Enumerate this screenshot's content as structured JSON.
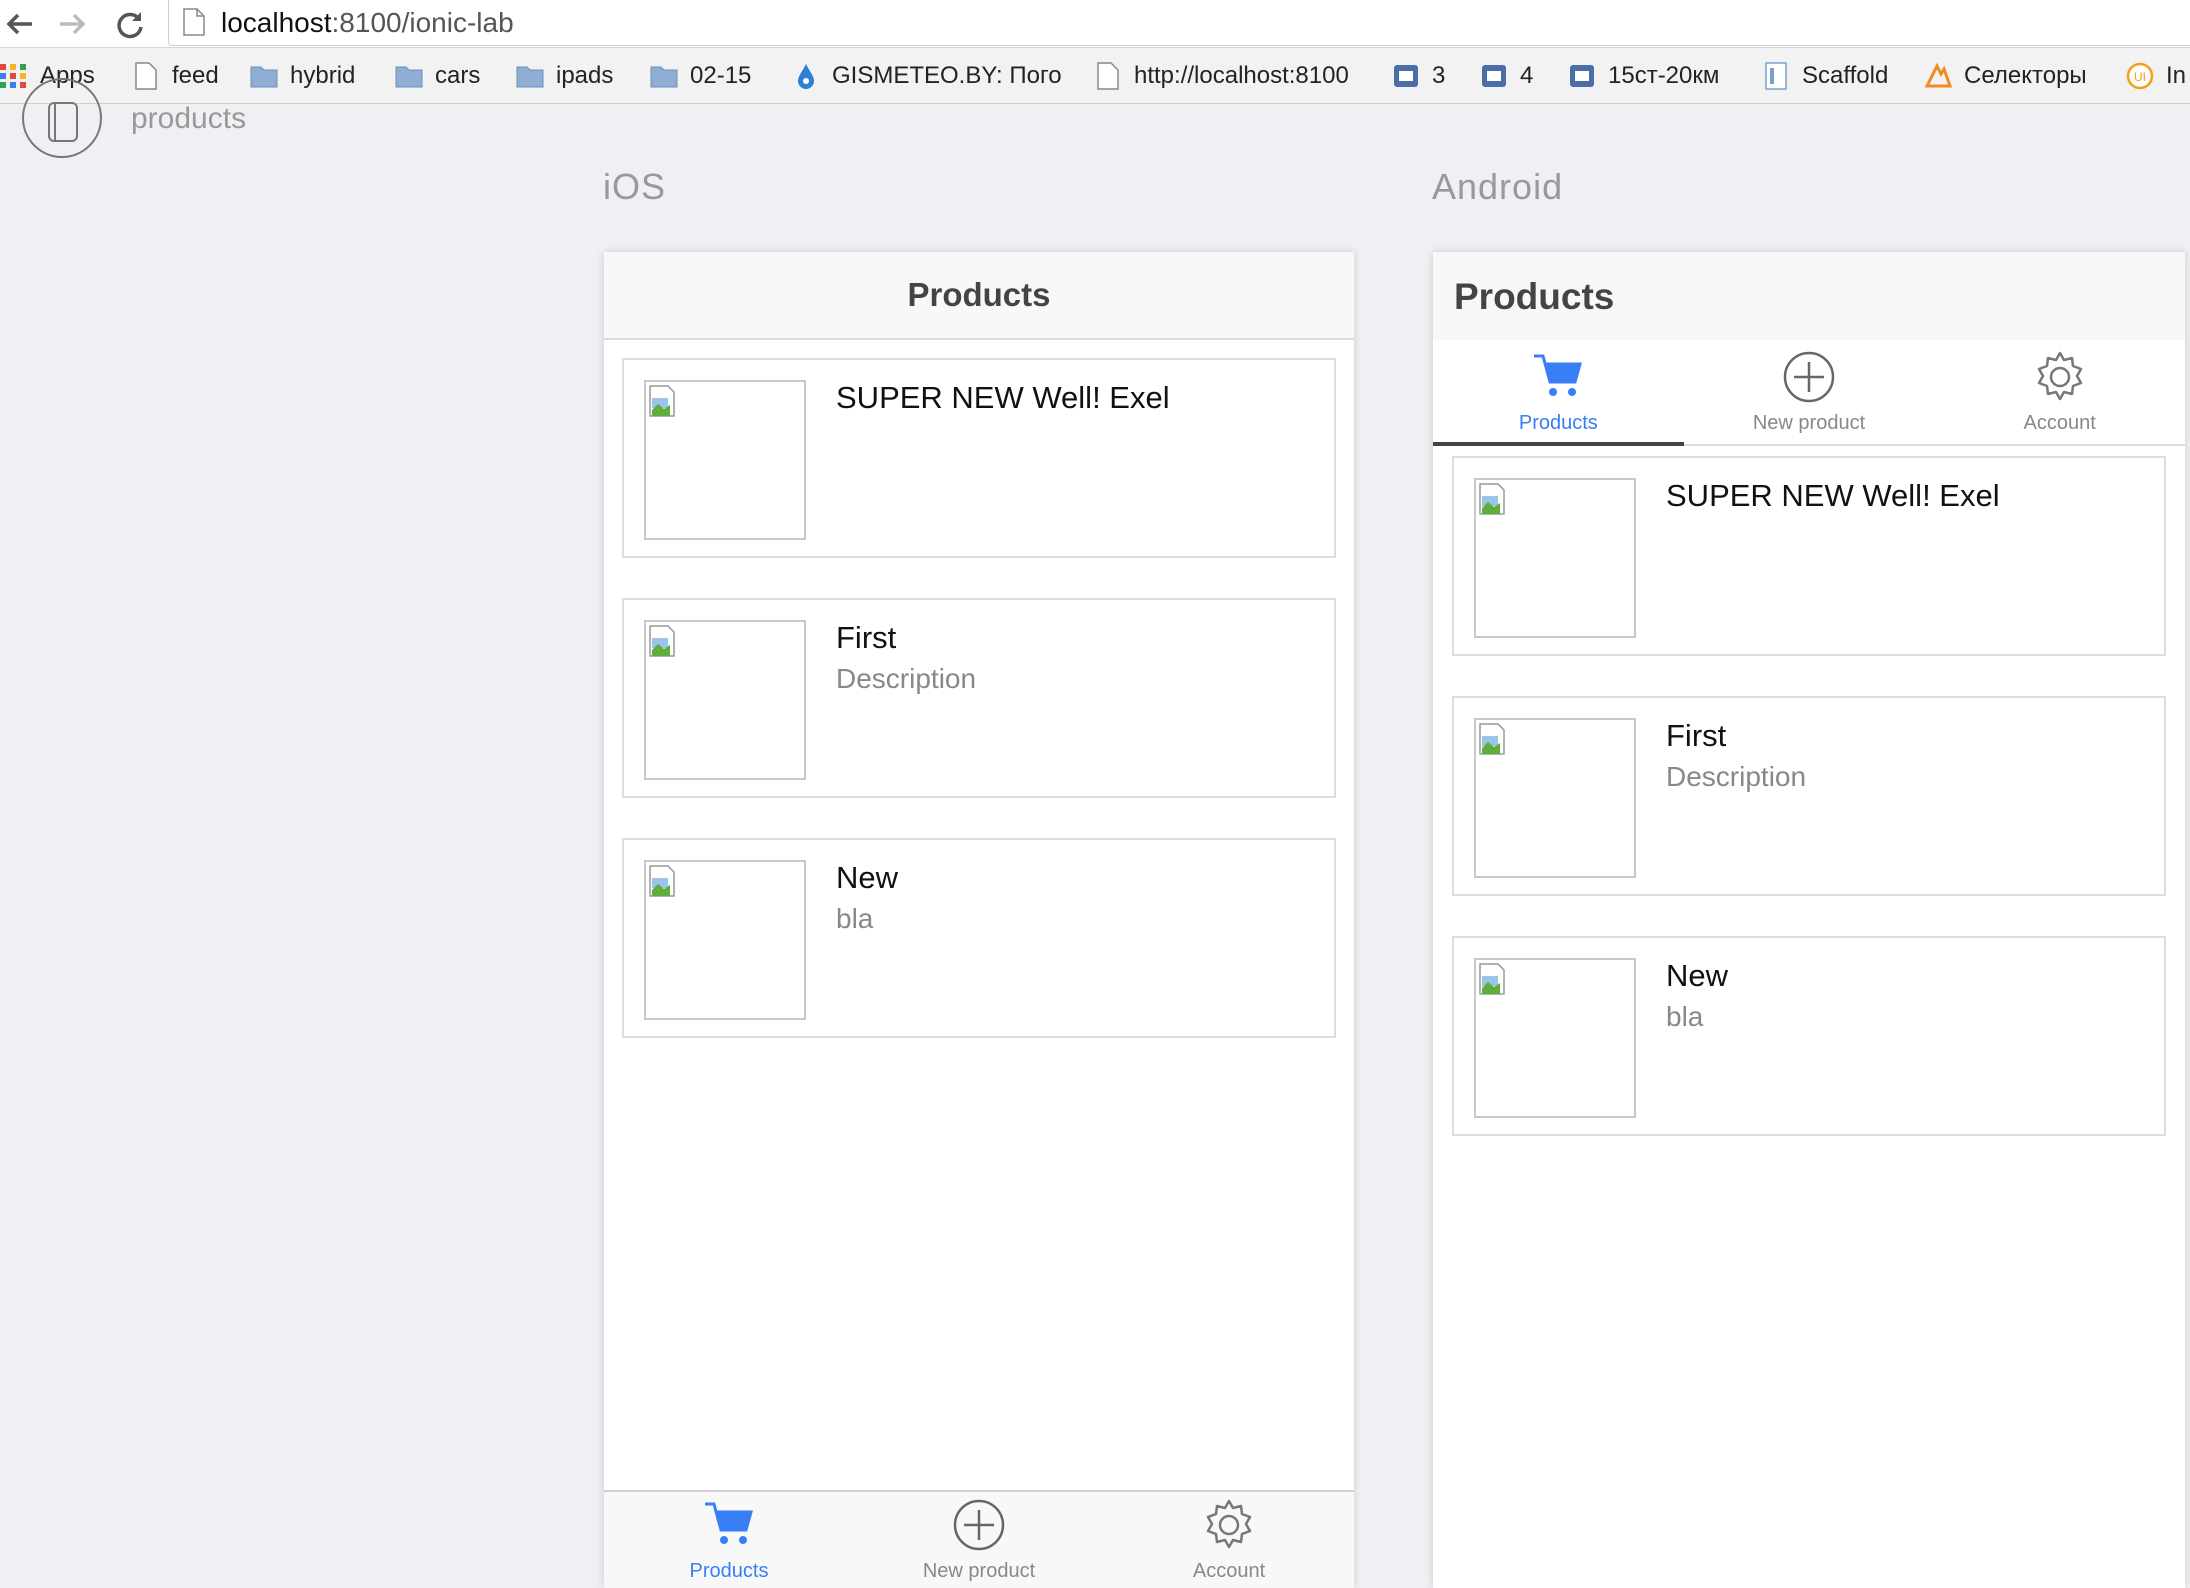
{
  "browser": {
    "url_host": "localhost",
    "url_rest": ":8100/ionic-lab",
    "bookmarks": [
      {
        "label": "Apps",
        "icon": "apps-grid-icon"
      },
      {
        "label": "feed",
        "icon": "page-icon"
      },
      {
        "label": "hybrid",
        "icon": "folder-icon"
      },
      {
        "label": "cars",
        "icon": "folder-icon"
      },
      {
        "label": "ipads",
        "icon": "folder-icon"
      },
      {
        "label": "02-15",
        "icon": "folder-icon"
      },
      {
        "label": "GISMETEO.BY: Пого",
        "icon": "drop-icon"
      },
      {
        "label": "http://localhost:8100",
        "icon": "page-icon"
      },
      {
        "label": "3",
        "icon": "vk-icon"
      },
      {
        "label": "4",
        "icon": "vk-icon"
      },
      {
        "label": "15ст-20км",
        "icon": "vk-icon"
      },
      {
        "label": "Scaffold",
        "icon": "doc-icon"
      },
      {
        "label": "Селекторы",
        "icon": "habr-icon"
      },
      {
        "label": "In",
        "icon": "ui-icon"
      }
    ]
  },
  "lab": {
    "title": "products",
    "ios_label": "iOS",
    "android_label": "Android"
  },
  "app": {
    "header_title": "Products",
    "tabs": [
      {
        "label": "Products",
        "icon": "cart-icon",
        "active": true
      },
      {
        "label": "New product",
        "icon": "add-circle-icon",
        "active": false
      },
      {
        "label": "Account",
        "icon": "gear-icon",
        "active": false
      }
    ],
    "products": [
      {
        "name": "SUPER NEW Well! Exel",
        "description": ""
      },
      {
        "name": "First",
        "description": "Description"
      },
      {
        "name": "New",
        "description": "bla"
      }
    ]
  },
  "colors": {
    "accent": "#387ef5",
    "page_bg": "#efeff4"
  }
}
